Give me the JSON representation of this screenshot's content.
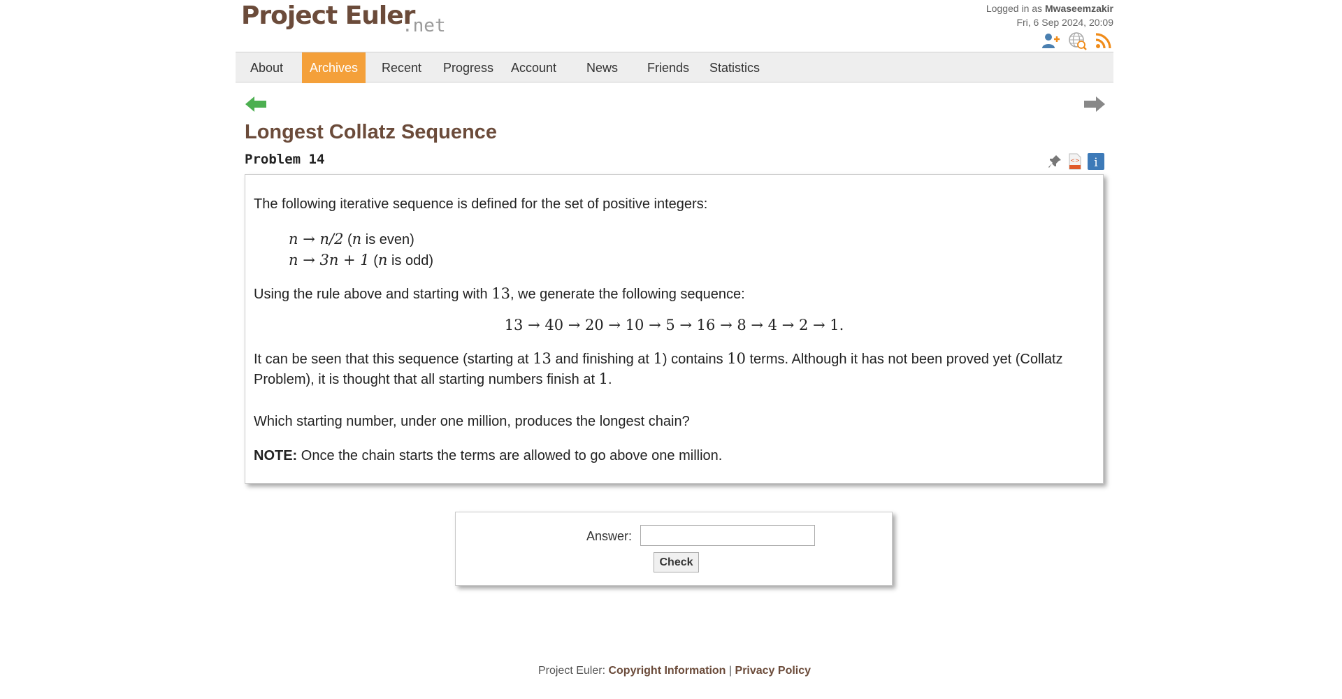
{
  "header": {
    "logo_main": "Project Euler",
    "logo_net": ".net",
    "logged_in_prefix": "Logged in as",
    "username": "Mwaseemzakir",
    "datetime": "Fri, 6 Sep 2024, 20:09",
    "icons": [
      "add-friend-icon",
      "translate-globe-icon",
      "rss-icon"
    ]
  },
  "nav": {
    "items": [
      {
        "label": "About"
      },
      {
        "label": "Archives",
        "active": true
      },
      {
        "label": "Recent"
      },
      {
        "label": "Progress"
      },
      {
        "label": "Account"
      },
      {
        "label": "News"
      },
      {
        "label": "Friends"
      },
      {
        "label": "Statistics"
      }
    ],
    "active_color": "#f4a03a"
  },
  "problem": {
    "title": "Longest Collatz Sequence",
    "number": "Problem 14",
    "icons": [
      "pin-icon",
      "html-file-icon",
      "info-icon"
    ],
    "intro": "The following iterative sequence is defined for the set of positive integers:",
    "rule1_expr": "n → n/2",
    "rule1_cond": "is even",
    "rule2_expr": "n → 3n + 1",
    "rule2_cond": "is odd",
    "using_text_a": "Using the rule above and starting with",
    "using_num": "13",
    "using_text_b": ", we generate the following sequence:",
    "sequence": "13 → 40 → 20 → 10 → 5 → 16 → 8 → 4 → 2 → 1.",
    "seen_a": "It can be seen that this sequence (starting at",
    "seen_n1": "13",
    "seen_b": "and finishing at",
    "seen_n2": "1",
    "seen_c": ") contains",
    "seen_n3": "10",
    "seen_d": "terms. Although it has not been proved yet (Collatz Problem), it is thought that all starting numbers finish at",
    "seen_n4": "1",
    "seen_e": ".",
    "question": "Which starting number, under one million, produces the longest chain?",
    "note_label": "NOTE:",
    "note_text": "Once the chain starts the terms are allowed to go above one million."
  },
  "answer": {
    "label": "Answer:",
    "value": "",
    "button": "Check"
  },
  "footer": {
    "prefix": "Project Euler:",
    "copyright": "Copyright Information",
    "separator": "|",
    "privacy": "Privacy Policy"
  },
  "colors": {
    "brand_brown": "#6b4b3a",
    "prev_arrow": "#4caf50",
    "next_arrow": "#888888"
  }
}
